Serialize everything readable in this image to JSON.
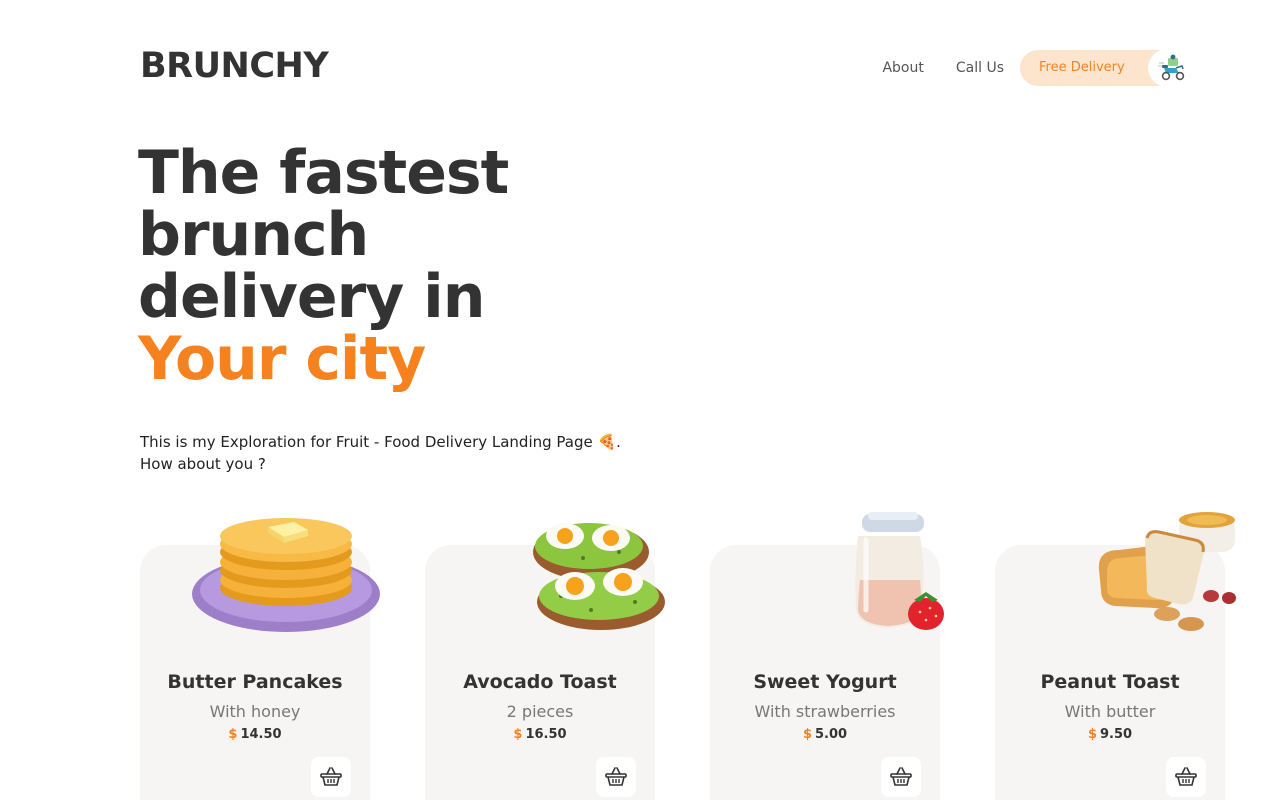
{
  "brand": {
    "logo": "BRUNCHY"
  },
  "nav": {
    "about": "About",
    "call": "Call Us",
    "delivery": "Free Delivery",
    "delivery_icon": "delivery-scooter-icon"
  },
  "hero": {
    "line1": "The fastest",
    "line2": "brunch",
    "line3": "delivery in",
    "line4": "Your city"
  },
  "intro": {
    "line1": "This is my Exploration for Fruit - Food Delivery Landing Page 🍕.",
    "line2": "How about you ?"
  },
  "products": [
    {
      "name": "Butter Pancakes",
      "detail": "With honey",
      "currency": "$",
      "price": "14.50",
      "image": "pancakes-image"
    },
    {
      "name": "Avocado Toast",
      "detail": "2 pieces",
      "currency": "$",
      "price": "16.50",
      "image": "avocado-toast-image"
    },
    {
      "name": "Sweet Yogurt",
      "detail": "With strawberries",
      "currency": "$",
      "price": "5.00",
      "image": "yogurt-jar-image"
    },
    {
      "name": "Peanut Toast",
      "detail": "With butter",
      "currency": "$",
      "price": "9.50",
      "image": "peanut-toast-image"
    }
  ],
  "colors": {
    "accent": "#f5821f",
    "text": "#333333",
    "card_bg": "#f7f5f3",
    "pill_bg": "#fde4cc"
  }
}
